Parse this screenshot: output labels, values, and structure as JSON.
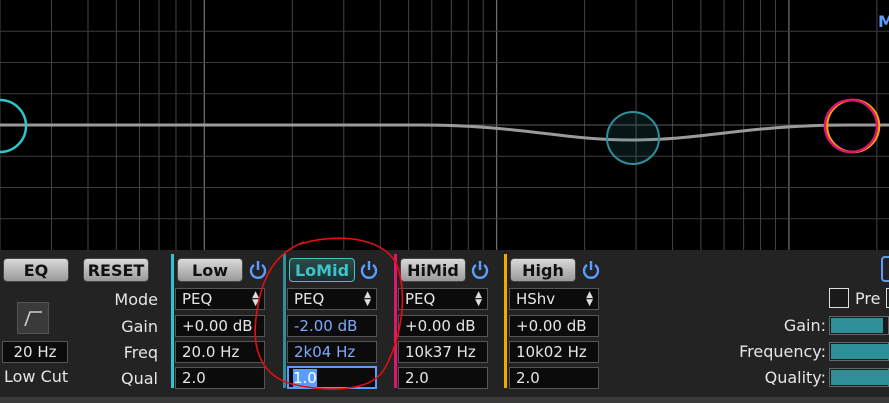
{
  "graph_label": "M",
  "top": {
    "eq_label": "EQ",
    "reset_label": "RESET"
  },
  "low_cut": {
    "freq": "20 Hz",
    "label": "Low Cut"
  },
  "row_labels": {
    "mode": "Mode",
    "gain": "Gain",
    "freq": "Freq",
    "qual": "Qual"
  },
  "bands": [
    {
      "name": "Low",
      "mode": "PEQ",
      "gain": "+0.00 dB",
      "freq": "20.0 Hz",
      "qual": "2.0",
      "color": "#2fc4c9"
    },
    {
      "name": "LoMid",
      "mode": "PEQ",
      "gain": "-2.00 dB",
      "freq": "2k04 Hz",
      "qual": "1.0",
      "color": "#2f8f99"
    },
    {
      "name": "HiMid",
      "mode": "PEQ",
      "gain": "+0.00 dB",
      "freq": "10k37 Hz",
      "qual": "2.0",
      "color": "#e0156e"
    },
    {
      "name": "High",
      "mode": "HShv",
      "gain": "+0.00 dB",
      "freq": "10k02 Hz",
      "qual": "2.0",
      "color": "#f2a900"
    }
  ],
  "right": {
    "pre_label": "Pre",
    "gain_label": "Gain:",
    "frequency_label": "Frequency:",
    "quality_label": "Quality:"
  },
  "colors": {
    "accent_blue": "#5b9cff",
    "active_teal": "#3ec3c8",
    "annotation_red": "#e01010"
  }
}
